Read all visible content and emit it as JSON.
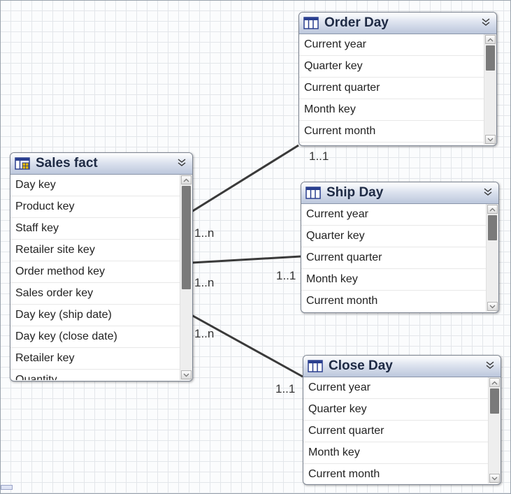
{
  "tables": [
    {
      "id": "order_day",
      "title": "Order Day",
      "rows": [
        "Current year",
        "Quarter key",
        "Current quarter",
        "Month key",
        "Current month"
      ]
    },
    {
      "id": "sales_fact",
      "title": "Sales fact",
      "rows": [
        "Day key",
        "Product key",
        "Staff key",
        "Retailer site key",
        "Order method key",
        "Sales order key",
        "Day key  (ship date)",
        "Day key  (close date)",
        "Retailer key",
        "Quantity"
      ]
    },
    {
      "id": "ship_day",
      "title": "Ship Day",
      "rows": [
        "Current year",
        "Quarter key",
        "Current quarter",
        "Month key",
        "Current month"
      ]
    },
    {
      "id": "close_day",
      "title": "Close Day",
      "rows": [
        "Current year",
        "Quarter key",
        "Current quarter",
        "Month key",
        "Current month"
      ]
    }
  ],
  "relationships": [
    {
      "from": "sales_fact",
      "to": "order_day",
      "from_card": "1..n",
      "to_card": "1..1"
    },
    {
      "from": "sales_fact",
      "to": "ship_day",
      "from_card": "1..n",
      "to_card": "1..1"
    },
    {
      "from": "sales_fact",
      "to": "close_day",
      "from_card": "1..n",
      "to_card": "1..1"
    }
  ],
  "colors": {
    "header_top": "#ffffff",
    "header_bottom": "#bcc7dc",
    "line": "#3a3a3a",
    "icon": "#2a3f8f"
  },
  "icons": {
    "table": "table-grid-icon",
    "fact": "fact-table-icon",
    "collapse": "double-chevron-down-icon"
  }
}
